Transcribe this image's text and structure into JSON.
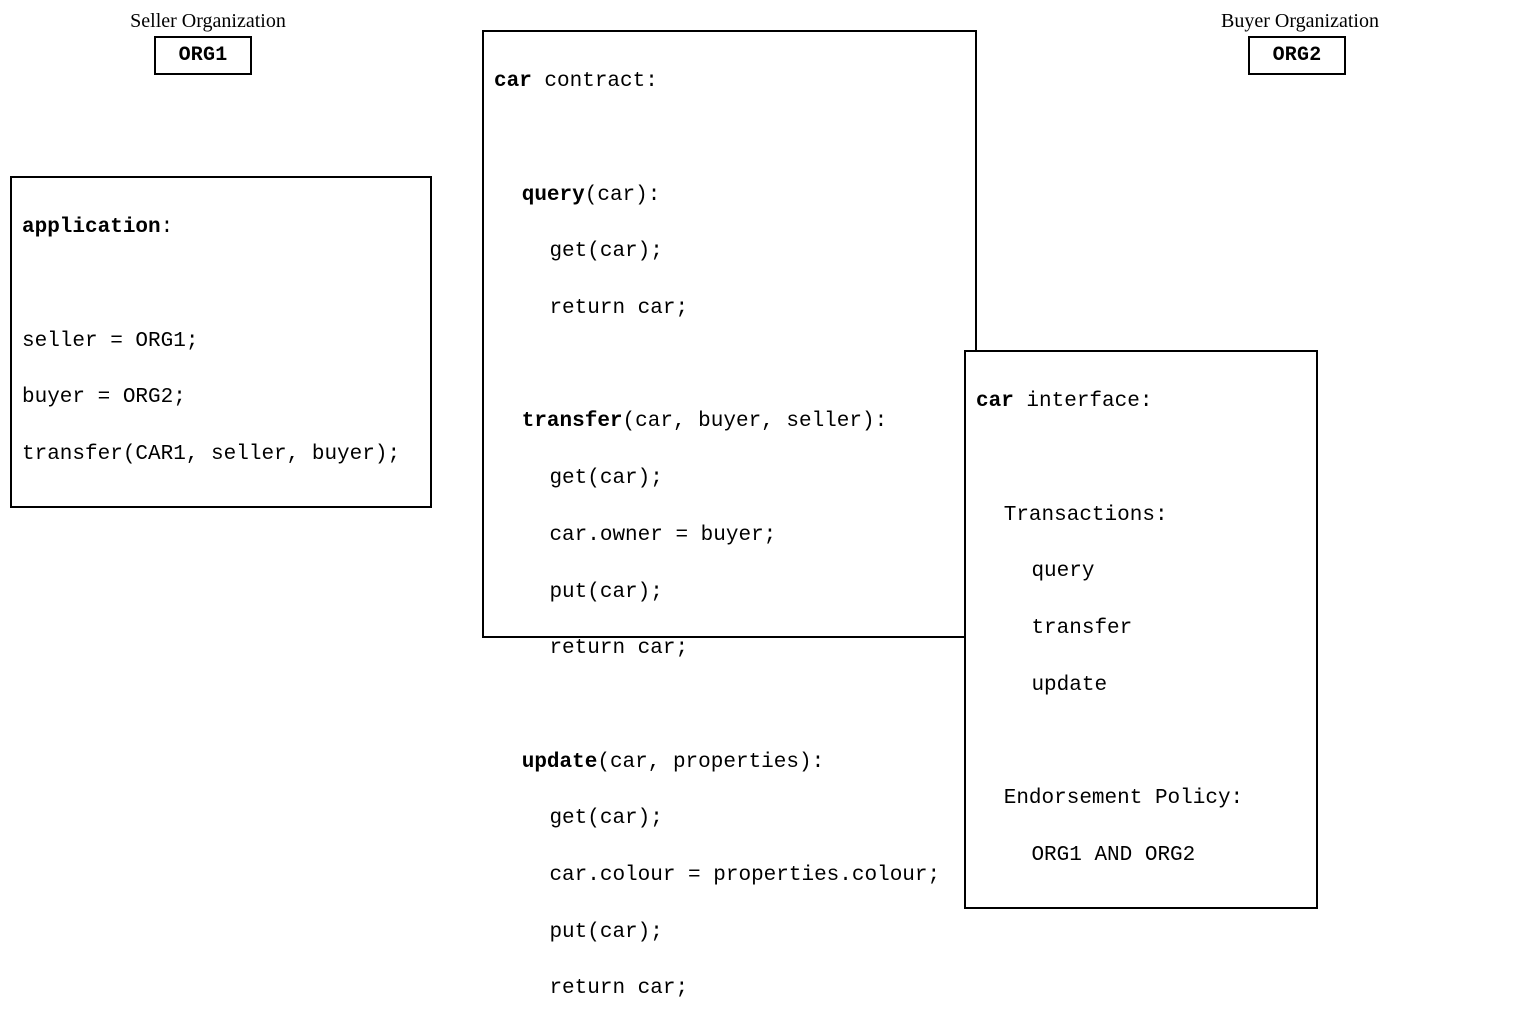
{
  "seller_label": "Seller Organization",
  "buyer_label": "Buyer Organization",
  "org1": "ORG1",
  "org2": "ORG2",
  "app": {
    "title_kw": "application",
    "title_rest": ":",
    "l1": "seller = ORG1;",
    "l2": "buyer = ORG2;",
    "l3": "transfer(CAR1, seller, buyer);"
  },
  "contract": {
    "title_kw": "car",
    "title_rest": " contract:",
    "q_kw": "query",
    "q_sig": "(car):",
    "q_l1": "get(car);",
    "q_l2": "return car;",
    "t_kw": "transfer",
    "t_sig": "(car, buyer, seller):",
    "t_l1": "get(car);",
    "t_l2": "car.owner = buyer;",
    "t_l3": "put(car);",
    "t_l4": "return car;",
    "u_kw": "update",
    "u_sig": "(car, properties):",
    "u_l1": "get(car);",
    "u_l2": "car.colour = properties.colour;",
    "u_l3": "put(car);",
    "u_l4": "return car;"
  },
  "iface": {
    "title_kw": "car",
    "title_rest": " interface:",
    "tx_header": "Transactions:",
    "tx1": "query",
    "tx2": "transfer",
    "tx3": "update",
    "ep_header": "Endorsement Policy:",
    "ep_val": "ORG1 AND ORG2"
  }
}
